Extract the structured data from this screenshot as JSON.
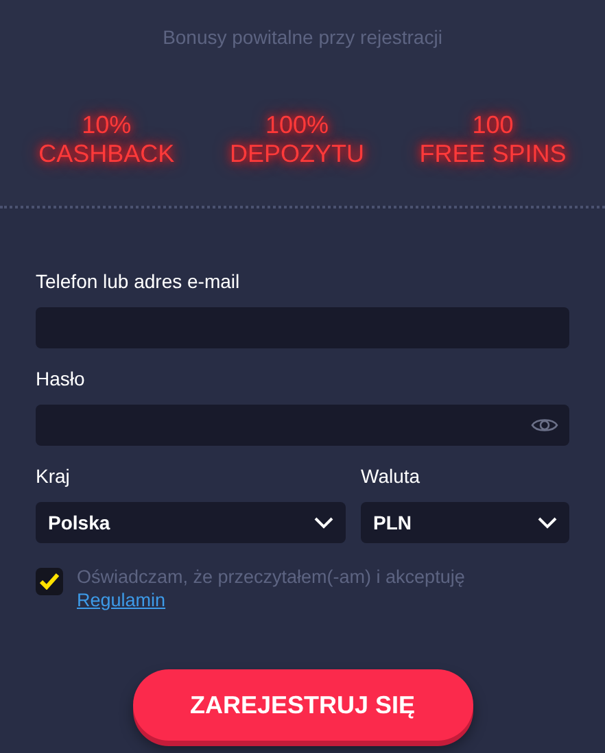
{
  "header": {
    "title": "Bonusy powitalne przy rejestracji",
    "bonuses": [
      {
        "value": "10%",
        "label": "CASHBACK"
      },
      {
        "value": "100%",
        "label": "DEPOZYTU"
      },
      {
        "value": "100",
        "label": "FREE SPINS"
      }
    ]
  },
  "form": {
    "login_label": "Telefon lub adres e-mail",
    "password_label": "Hasło",
    "country": {
      "label": "Kraj",
      "value": "Polska"
    },
    "currency": {
      "label": "Waluta",
      "value": "PLN"
    },
    "consent": {
      "checked": true,
      "text": "Oświadczam, że przeczytałem(-am) i akceptuję",
      "link": "Regulamin"
    },
    "submit": "ZAREJESTRUJ SIĘ"
  }
}
